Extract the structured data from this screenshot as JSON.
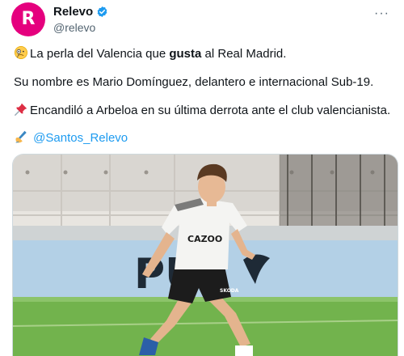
{
  "account": {
    "display_name": "Relevo",
    "handle": "@relevo",
    "avatar_letter": "R",
    "verified": true
  },
  "tweet": {
    "line1_before": "La perla del Valencia que ",
    "line1_bold": "gusta",
    "line1_after": " al Real Madrid.",
    "line2": "Su nombre es Mario Domínguez, delantero e internacional Sub-19.",
    "line3": "Encandiló a Arbeloa en su última derrota ante el club valencianista.",
    "mention": "@Santos_Relevo"
  },
  "photo": {
    "shirt_sponsor": "CAZOO",
    "banner_text": "PU",
    "shorts_text": "SKODA"
  },
  "colors": {
    "brand": "#e5007e",
    "link": "#1d9bf0",
    "verified": "#1d9bf0",
    "text": "#0f1419",
    "muted": "#536471"
  },
  "icons": {
    "verified": "verified-badge-icon",
    "more": "more-options-icon",
    "emoji_line1": "monocle-face-emoji",
    "emoji_line3": "pushpin-emoji",
    "emoji_line4": "writing-hand-emoji"
  }
}
